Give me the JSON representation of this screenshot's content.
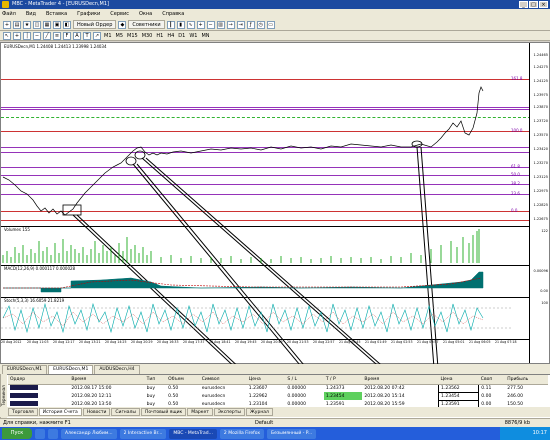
{
  "window": {
    "title": "MBC - MetaTrader 4 - [EURUSDecn,M1]",
    "min": "_",
    "max": "□",
    "close": "×"
  },
  "menu": [
    "Файл",
    "Вид",
    "Вставка",
    "Графики",
    "Сервис",
    "Окна",
    "Справка"
  ],
  "toolbar": {
    "new_order": "Новый Ордер",
    "advisors": "Советники"
  },
  "timeframes": [
    "M1",
    "M5",
    "M15",
    "M30",
    "H1",
    "H4",
    "D1",
    "W1",
    "MN"
  ],
  "chart": {
    "header": "EURUSDecn,M1  1.24408 1.24413 1.23998 1.24034",
    "volumes_label": "Volumes 155",
    "macd_label": "MACD(12,26,9) 0.000117 0.000028",
    "stoch_label": "Stoch(5,3,3) 16.6059 21.8219",
    "prices": [
      "1.24465",
      "1.24275",
      "1.24125",
      "1.23975",
      "1.23870",
      "1.23720",
      "1.23570",
      "1.23420",
      "1.23270",
      "1.23125",
      "1.22975",
      "1.22825",
      "1.22675"
    ],
    "fib_labels": [
      "161.8",
      "100.0",
      "61.8",
      "50.0",
      "38.2",
      "23.6",
      "0.0"
    ],
    "sub_prices": [
      "122",
      "0.00096",
      "0.00",
      "100"
    ],
    "time_labels": [
      "20 Aug 2012",
      "20 Aug 11:03",
      "20 Aug 12:17",
      "20 Aug 13:21",
      "20 Aug 14:25",
      "20 Aug 20:29",
      "20 Aug 16:33",
      "20 Aug 17:37",
      "20 Aug 18:41",
      "20 Aug 19:45",
      "20 Aug 20:49",
      "20 Aug 21:53",
      "20 Aug 22:57",
      "21 Aug 00:45",
      "21 Aug 01:49",
      "21 Aug 02:53",
      "21 Aug 03:57",
      "21 Aug 05:01",
      "21 Aug 06:05",
      "21 Aug 07:18"
    ]
  },
  "chart_tabs": [
    "EURUSDecn,M1",
    "EURUSDecn,M1",
    "AUDUSDecn,H4"
  ],
  "terminal": {
    "side_label": "Терминал",
    "columns": [
      "Ордер",
      "",
      "Время",
      "Тип",
      "Объем",
      "Символ",
      "Цена",
      "S / L",
      "T / P",
      "Время",
      "Цена",
      "Своп",
      "Прибыль"
    ],
    "rows": [
      {
        "time": "2012.08.17 15:00",
        "type": "buy",
        "volume": "0.50",
        "symbol": "eurusdecn",
        "price": "1.23607",
        "sl": "0.00000",
        "tp": "1.24373",
        "ctime": "2012.08.20 07:42",
        "cprice": "1.23562",
        "swap": "0.11",
        "profit": "277.50"
      },
      {
        "time": "2012.08.20 12:11",
        "type": "buy",
        "volume": "0.50",
        "symbol": "eurusdecn",
        "price": "1.22962",
        "sl": "0.00000",
        "tp": "1.23454",
        "ctime": "2012.08.20 15:14",
        "cprice": "1.23454",
        "swap": "0.00",
        "profit": "246.00"
      },
      {
        "time": "2012.08.20 13:50",
        "type": "buy",
        "volume": "0.50",
        "symbol": "eurusdecn",
        "price": "1.23104",
        "sl": "0.00000",
        "tp": "1.23591",
        "ctime": "2012.08.20 15:59",
        "cprice": "1.23591",
        "swap": "0.00",
        "profit": "150.50"
      }
    ]
  },
  "bottom_tabs": [
    "Торговля",
    "История Счета",
    "Новости",
    "Сигналы",
    "Почтовый ящик",
    "Маркет",
    "Эксперты",
    "Журнал"
  ],
  "status": {
    "left": "Для справки, нажмите F1",
    "mid": "Default",
    "right": "8876/9 kb"
  },
  "taskbar": {
    "start": "Пуск",
    "tasks": [
      "",
      "",
      "Александр Любим...",
      "2 Interactive Br...",
      "MBC - MetaTrad...",
      "2 Mozilla Firefox",
      "Безымянный - P..."
    ],
    "clock": "10:17"
  },
  "colors": {
    "bull": "#000000",
    "volume": "#00a000",
    "macd": "#007070",
    "stoch": "#00aaaa",
    "fib": "#7a00a8"
  }
}
